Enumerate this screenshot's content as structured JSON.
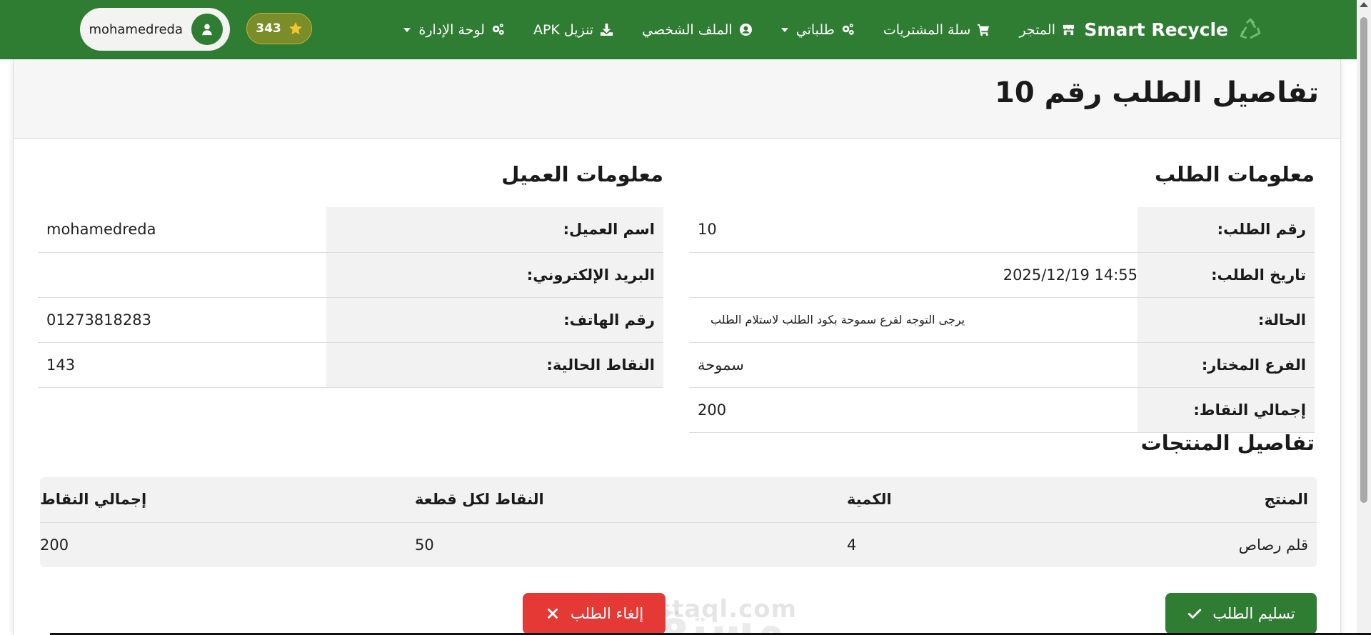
{
  "nav": {
    "brand": "Smart Recycle",
    "links": [
      {
        "label": "المتجر",
        "icon": "store-icon"
      },
      {
        "label": "سلة المشتريات",
        "icon": "cart-icon"
      },
      {
        "label": "طلباتي",
        "icon": "gears-icon",
        "dropdown": true
      },
      {
        "label": "الملف الشخصي",
        "icon": "user-circle-icon"
      },
      {
        "label": "تنزيل APK",
        "icon": "download-icon"
      },
      {
        "label": "لوحة الإدارة",
        "icon": "gears-icon",
        "dropdown": true
      }
    ],
    "points": "343",
    "username": "mohamedreda"
  },
  "page": {
    "title": "تفاصيل الطلب رقم 10"
  },
  "order_info": {
    "heading": "معلومات الطلب",
    "rows": [
      {
        "label": "رقم الطلب:",
        "value": "10"
      },
      {
        "label": "تاريخ الطلب:",
        "value": "2025/12/19 14:55"
      },
      {
        "label": "الحالة:",
        "value": "يرجى التوجه لفرع سموحة بكود الطلب لاستلام الطلب"
      },
      {
        "label": "الفرع المختار:",
        "value": "سموحة"
      },
      {
        "label": "إجمالي النقاط:",
        "value": "200"
      }
    ]
  },
  "customer_info": {
    "heading": "معلومات العميل",
    "rows": [
      {
        "label": "اسم العميل:",
        "value": "mohamedreda"
      },
      {
        "label": "البريد الإلكتروني:",
        "value": ""
      },
      {
        "label": "رقم الهاتف:",
        "value": "01273818283"
      },
      {
        "label": "النقاط الحالية:",
        "value": "143"
      }
    ]
  },
  "products": {
    "heading": "تفاصيل المنتجات",
    "columns": [
      "المنتج",
      "الكمية",
      "النقاط لكل قطعة",
      "إجمالي النقاط"
    ],
    "rows": [
      [
        "قلم رصاص",
        "4",
        "50",
        "200"
      ]
    ]
  },
  "actions": {
    "deliver": "تسليم الطلب",
    "cancel": "إلغاء الطلب"
  },
  "watermark": {
    "arabic": "مستقل",
    "latin": "mostaql.com"
  },
  "colors": {
    "primary": "#2e7d32",
    "danger": "#e53935",
    "star": "#f4c430"
  }
}
